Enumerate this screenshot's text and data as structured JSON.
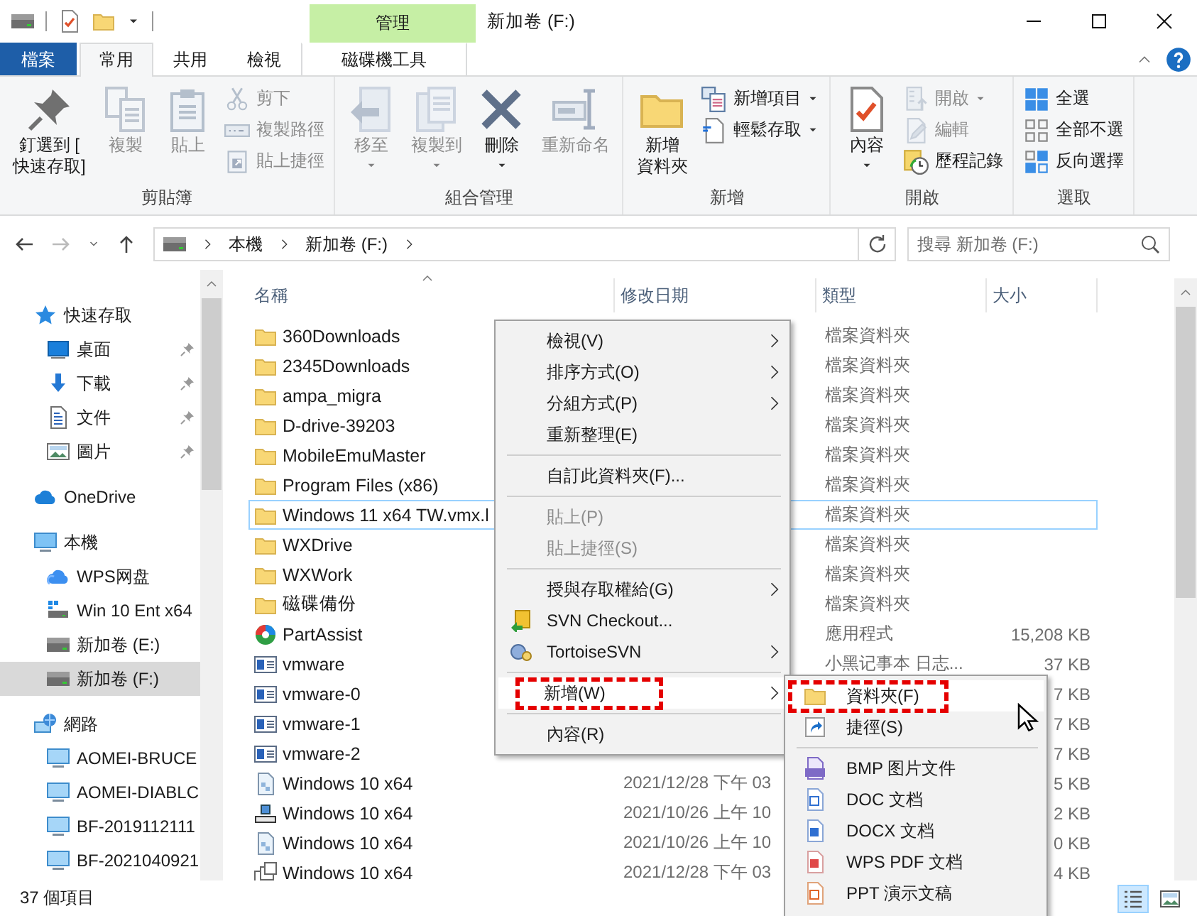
{
  "window": {
    "title": "新加卷 (F:)",
    "context_header": "管理"
  },
  "tabs": [
    {
      "label": "檔案",
      "kind": "file",
      "selected": false
    },
    {
      "label": "常用",
      "kind": "tab",
      "selected": true
    },
    {
      "label": "共用",
      "kind": "tab",
      "selected": false
    },
    {
      "label": "檢視",
      "kind": "tab",
      "selected": false
    },
    {
      "label": "磁碟機工具",
      "kind": "context",
      "selected": false
    }
  ],
  "ribbon": {
    "groups": [
      {
        "label": "剪貼簿",
        "large": [
          {
            "lines": [
              "釘選到 [",
              "快速存取]"
            ],
            "kind": "pin",
            "disabled": false,
            "dropdown": false
          },
          {
            "lines": [
              "複製"
            ],
            "kind": "copy",
            "disabled": true,
            "dropdown": false
          },
          {
            "lines": [
              "貼上"
            ],
            "kind": "paste",
            "disabled": true,
            "dropdown": false
          }
        ],
        "small": [
          {
            "label": "剪下",
            "kind": "cut",
            "disabled": true,
            "dropdown": false
          },
          {
            "label": "複製路徑",
            "kind": "path",
            "disabled": true,
            "dropdown": false
          },
          {
            "label": "貼上捷徑",
            "kind": "pasteshortcut",
            "disabled": true,
            "dropdown": false
          }
        ]
      },
      {
        "label": "組合管理",
        "large": [
          {
            "lines": [
              "移至"
            ],
            "kind": "move",
            "disabled": true,
            "dropdown": true
          },
          {
            "lines": [
              "複製到"
            ],
            "kind": "copyto",
            "disabled": true,
            "dropdown": true
          },
          {
            "lines": [
              "刪除"
            ],
            "kind": "delete",
            "disabled": false,
            "dropdown": true
          },
          {
            "lines": [
              "重新命名"
            ],
            "kind": "rename",
            "disabled": true,
            "dropdown": false
          }
        ]
      },
      {
        "label": "新增",
        "large": [
          {
            "lines": [
              "新增",
              "資料夾"
            ],
            "kind": "folder",
            "disabled": false,
            "dropdown": false
          }
        ],
        "small": [
          {
            "label": "新增項目",
            "kind": "newitem",
            "disabled": false,
            "dropdown": true
          },
          {
            "label": "輕鬆存取",
            "kind": "easyaccess",
            "disabled": false,
            "dropdown": true
          }
        ]
      },
      {
        "label": "開啟",
        "large": [
          {
            "lines": [
              "內容"
            ],
            "kind": "checkdoc",
            "disabled": false,
            "dropdown": true
          }
        ],
        "small": [
          {
            "label": "開啟",
            "kind": "open",
            "disabled": true,
            "dropdown": true
          },
          {
            "label": "編輯",
            "kind": "edit",
            "disabled": true,
            "dropdown": false
          },
          {
            "label": "歷程記錄",
            "kind": "history",
            "disabled": false,
            "dropdown": false
          }
        ]
      },
      {
        "label": "選取",
        "small": [
          {
            "label": "全選",
            "kind": "selall",
            "disabled": false,
            "dropdown": false
          },
          {
            "label": "全部不選",
            "kind": "selnone",
            "disabled": false,
            "dropdown": false
          },
          {
            "label": "反向選擇",
            "kind": "invert",
            "disabled": false,
            "dropdown": false
          }
        ]
      }
    ]
  },
  "address": {
    "crumbs": [
      "本機",
      "新加卷 (F:)"
    ],
    "search_placeholder": "搜尋 新加卷 (F:)"
  },
  "navigation": [
    {
      "label": "快速存取",
      "kind": "star",
      "selected": false,
      "children": [
        {
          "label": "桌面",
          "kind": "desktop",
          "pinned": true,
          "selected": false
        },
        {
          "label": "下載",
          "kind": "download",
          "pinned": true,
          "selected": false
        },
        {
          "label": "文件",
          "kind": "document",
          "pinned": true,
          "selected": false
        },
        {
          "label": "圖片",
          "kind": "picture",
          "pinned": true,
          "selected": false
        }
      ]
    },
    {
      "label": "OneDrive",
      "kind": "cloud",
      "selected": false
    },
    {
      "label": "本機",
      "kind": "pc",
      "selected": false,
      "children": [
        {
          "label": "WPS网盘",
          "kind": "wpscloud",
          "selected": false
        },
        {
          "label": "Win 10 Ent x64",
          "kind": "drivewin",
          "selected": false
        },
        {
          "label": "新加卷 (E:)",
          "kind": "drive",
          "selected": false
        },
        {
          "label": "新加卷 (F:)",
          "kind": "drive",
          "selected": true
        }
      ]
    },
    {
      "label": "網路",
      "kind": "network",
      "selected": false,
      "children": [
        {
          "label": "AOMEI-BRUCE",
          "kind": "computer",
          "selected": false
        },
        {
          "label": "AOMEI-DIABLC",
          "kind": "computer",
          "selected": false
        },
        {
          "label": "BF-2019112111",
          "kind": "computer",
          "selected": false
        },
        {
          "label": "BF-2021040921",
          "kind": "computer",
          "selected": false
        }
      ]
    }
  ],
  "columns": [
    "名稱",
    "修改日期",
    "類型",
    "大小"
  ],
  "files": [
    {
      "name": "360Downloads",
      "kind": "folder",
      "type": "檔案資料夾",
      "selected": false
    },
    {
      "name": "2345Downloads",
      "kind": "folder",
      "type": "檔案資料夾",
      "selected": false
    },
    {
      "name": "ampa_migra",
      "kind": "folder",
      "type": "檔案資料夾",
      "selected": false
    },
    {
      "name": "D-drive-39203",
      "kind": "folder",
      "type": "檔案資料夾",
      "selected": false
    },
    {
      "name": "MobileEmuMaster",
      "kind": "folder",
      "type": "檔案資料夾",
      "selected": false
    },
    {
      "name": "Program Files (x86)",
      "kind": "folder",
      "type": "檔案資料夾",
      "selected": false
    },
    {
      "name": "Windows 11 x64 TW.vmx.l",
      "kind": "folder",
      "type": "檔案資料夾",
      "selected": true
    },
    {
      "name": "WXDrive",
      "kind": "folder",
      "type": "檔案資料夾",
      "selected": false
    },
    {
      "name": "WXWork",
      "kind": "folder",
      "type": "檔案資料夾",
      "selected": false
    },
    {
      "name": "磁碟備份",
      "kind": "folder",
      "type": "檔案資料夾",
      "selected": false
    },
    {
      "name": "PartAssist",
      "kind": "app",
      "type": "應用程式",
      "size": "15,208 KB",
      "selected": false
    },
    {
      "name": "vmware",
      "kind": "log",
      "type": "小黑记事本 日志...",
      "size": "37 KB",
      "selected": false
    },
    {
      "name": "vmware-0",
      "kind": "log",
      "size": "7 KB",
      "selected": false
    },
    {
      "name": "vmware-1",
      "kind": "log",
      "size": "7 KB",
      "selected": false
    },
    {
      "name": "vmware-2",
      "kind": "log",
      "size": "7 KB",
      "selected": false
    },
    {
      "name": "Windows 10 x64",
      "kind": "vmdoc",
      "date": "2021/12/28 下午 03",
      "size": "5 KB",
      "selected": false
    },
    {
      "name": "Windows 10 x64",
      "kind": "vmdisk",
      "date": "2021/10/26 上午 10",
      "size": "2 KB",
      "selected": false
    },
    {
      "name": "Windows 10 x64",
      "kind": "vmdoc",
      "date": "2021/10/26 上午 10",
      "size": "0 KB",
      "selected": false
    },
    {
      "name": "Windows 10 x64",
      "kind": "vmmulti",
      "date": "2021/12/28 下午 03",
      "size": "4 KB",
      "selected": false
    }
  ],
  "context_menu": [
    {
      "kind": "item",
      "label": "檢視(V)",
      "submenu": true,
      "disabled": false,
      "selected": false,
      "annotated": false
    },
    {
      "kind": "item",
      "label": "排序方式(O)",
      "submenu": true,
      "disabled": false,
      "selected": false,
      "annotated": false
    },
    {
      "kind": "item",
      "label": "分組方式(P)",
      "submenu": true,
      "disabled": false,
      "selected": false,
      "annotated": false
    },
    {
      "kind": "item",
      "label": "重新整理(E)",
      "submenu": false,
      "disabled": false,
      "selected": false,
      "annotated": false
    },
    {
      "kind": "separator"
    },
    {
      "kind": "item",
      "label": "自訂此資料夾(F)...",
      "submenu": false,
      "disabled": false,
      "selected": false,
      "annotated": false
    },
    {
      "kind": "separator"
    },
    {
      "kind": "item",
      "label": "貼上(P)",
      "submenu": false,
      "disabled": true,
      "selected": false,
      "annotated": false
    },
    {
      "kind": "item",
      "label": "貼上捷徑(S)",
      "submenu": false,
      "disabled": true,
      "selected": false,
      "annotated": false
    },
    {
      "kind": "separator"
    },
    {
      "kind": "item",
      "label": "授與存取權給(G)",
      "submenu": true,
      "disabled": false,
      "selected": false,
      "annotated": false
    },
    {
      "kind": "svn",
      "label": "SVN Checkout...",
      "submenu": false,
      "disabled": false,
      "selected": false,
      "annotated": false
    },
    {
      "kind": "tortoise",
      "label": "TortoiseSVN",
      "submenu": true,
      "disabled": false,
      "selected": false,
      "annotated": false
    },
    {
      "kind": "separator"
    },
    {
      "kind": "item",
      "label": "新增(W)",
      "submenu": true,
      "disabled": false,
      "selected": true,
      "annotated": true
    },
    {
      "kind": "separator"
    },
    {
      "kind": "item",
      "label": "內容(R)",
      "submenu": false,
      "disabled": false,
      "selected": false,
      "annotated": false
    }
  ],
  "new_submenu": [
    {
      "kind": "folder",
      "label": "資料夾(F)",
      "selected": true,
      "annotated": true
    },
    {
      "kind": "shortcut",
      "label": "捷徑(S)",
      "selected": false,
      "annotated": false
    },
    {
      "kind": "separator"
    },
    {
      "kind": "bmp",
      "label": "BMP 图片文件",
      "selected": false,
      "annotated": false
    },
    {
      "kind": "wdoc",
      "label": "DOC 文档",
      "selected": false,
      "annotated": false
    },
    {
      "kind": "wdocx",
      "label": "DOCX 文档",
      "selected": false,
      "annotated": false
    },
    {
      "kind": "pdf",
      "label": "WPS PDF 文档",
      "selected": false,
      "annotated": false
    },
    {
      "kind": "ppt",
      "label": "PPT 演示文稿",
      "selected": false,
      "annotated": false
    }
  ],
  "status_bar": {
    "count": "37 個項目",
    "views": [
      {
        "kind": "details",
        "selected": true
      },
      {
        "kind": "largeicons",
        "selected": false
      }
    ]
  }
}
